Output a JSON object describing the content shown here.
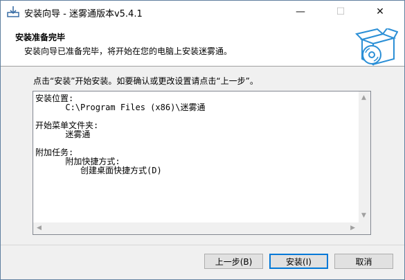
{
  "window": {
    "title": "安装向导 - 迷雾通版本v5.4.1",
    "minimize_glyph": "—",
    "maximize_glyph": "☐",
    "close_glyph": "✕"
  },
  "header": {
    "title": "安装准备完毕",
    "subtitle": "安装向导已准备完毕，将开始在您的电脑上安装迷雾通。"
  },
  "main": {
    "intro": "点击“安装”开始安装。如要确认或更改设置请点击“上一步”。",
    "memo_lines": [
      "安装位置:",
      "      C:\\Program Files (x86)\\迷雾通",
      "",
      "开始菜单文件夹:",
      "      迷雾通",
      "",
      "附加任务:",
      "      附加快捷方式:",
      "         创建桌面快捷方式(D)"
    ]
  },
  "buttons": {
    "back": "上一步(B)",
    "install": "安装(I)",
    "cancel": "取消"
  },
  "colors": {
    "accent": "#0078d7",
    "logo": "#2b8fd6"
  },
  "icons": {
    "app": "installer-download-icon",
    "logo": "box-with-disc-icon"
  }
}
